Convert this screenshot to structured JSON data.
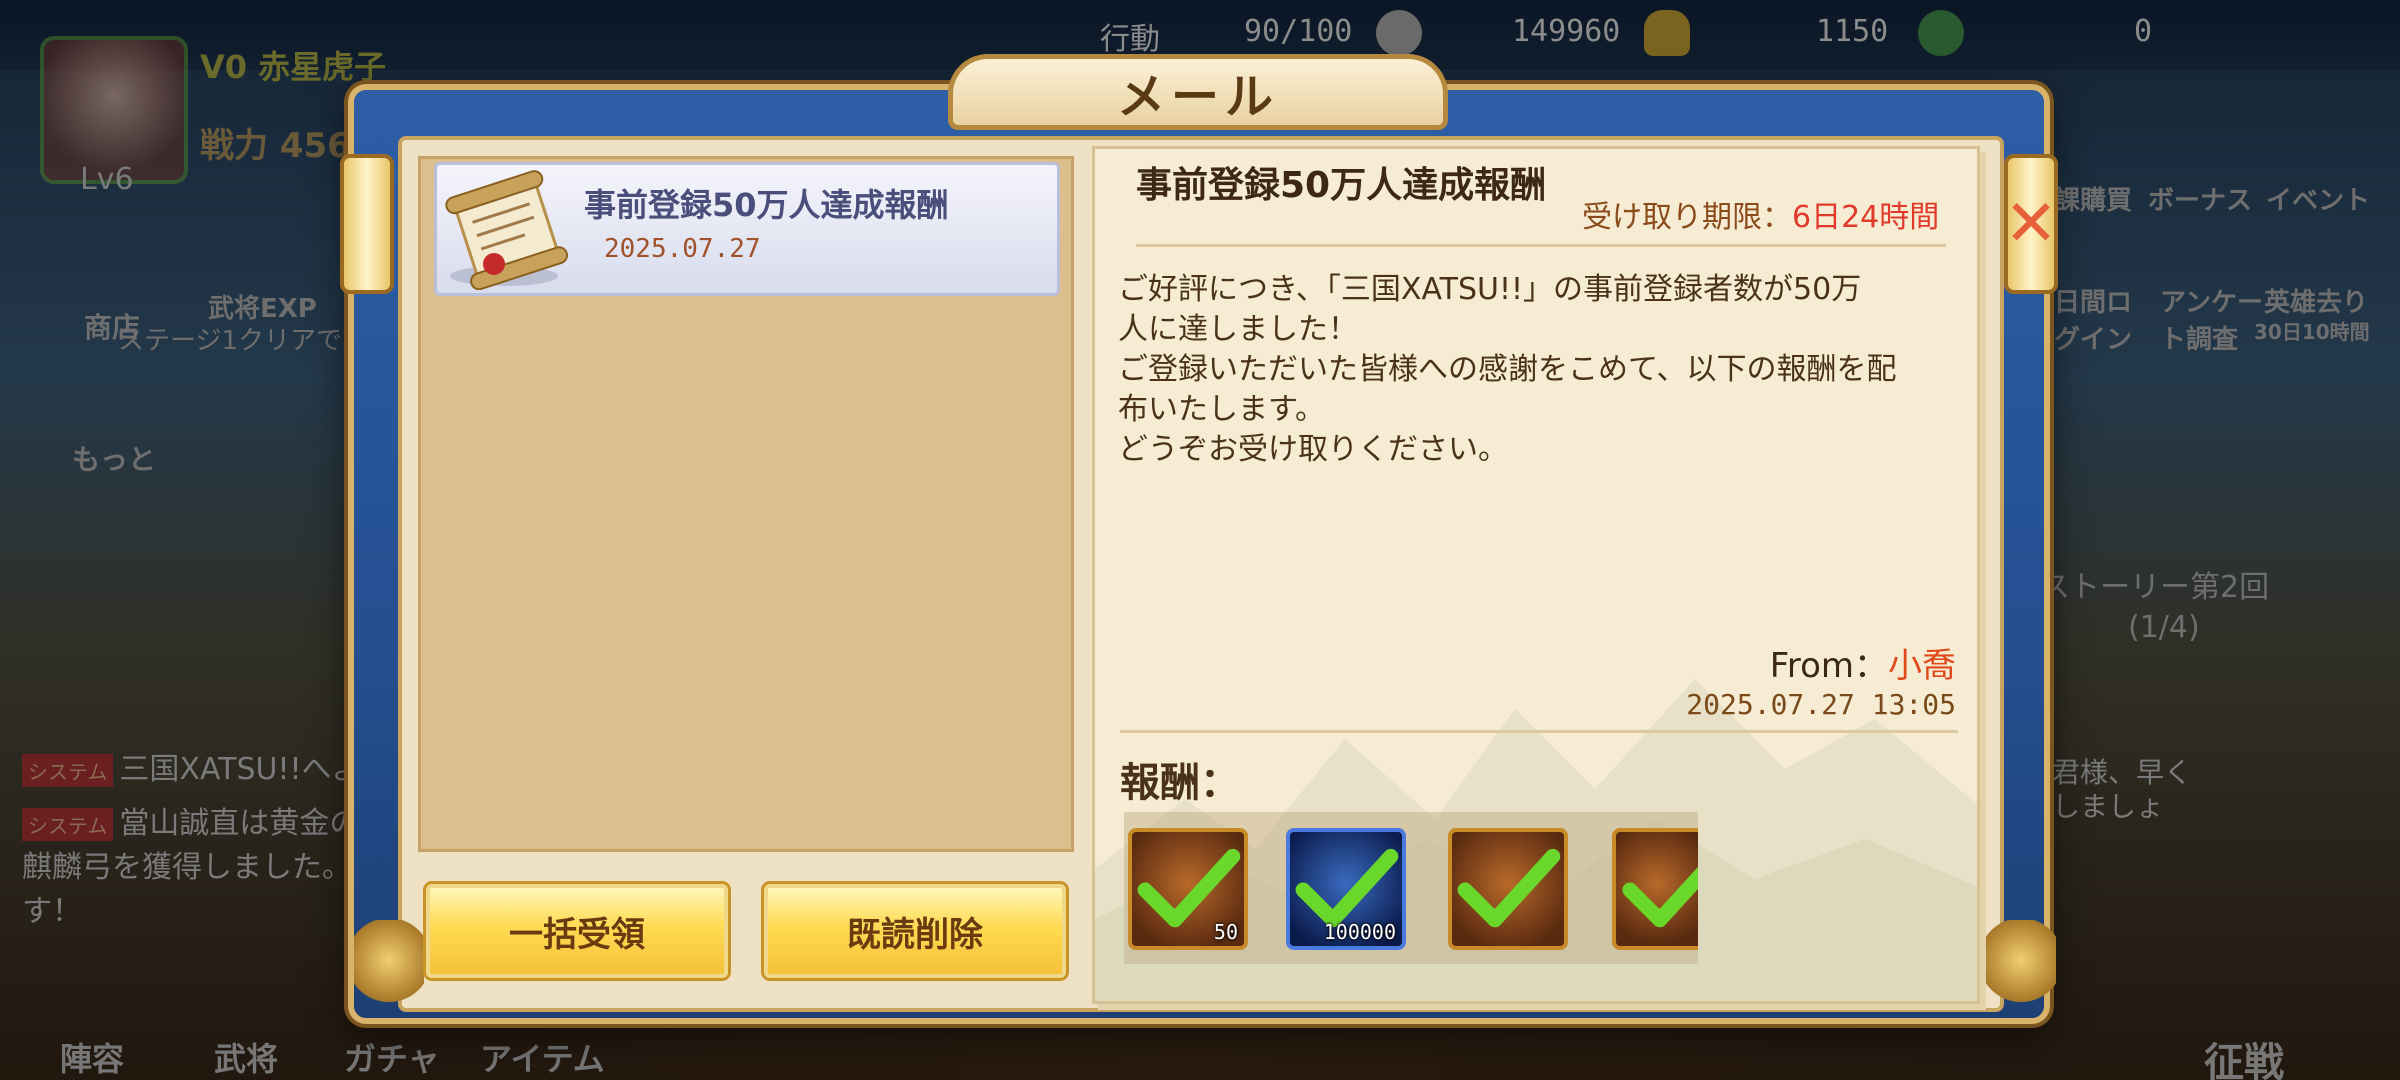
{
  "hud": {
    "stamina_label": "行動",
    "stamina": "90/100",
    "silver": "149960",
    "gold": "1150",
    "jade": "0",
    "player_name": "赤星虎子",
    "vip": "V0",
    "power_label": "戦力",
    "power": "456",
    "level": "Lv6"
  },
  "background": {
    "left_labels": [
      "商店",
      "武将EXP",
      "ステージ1クリアで",
      "もっと"
    ],
    "right_labels": [
      "課購買",
      "ボーナス",
      "イベント",
      "日間ロ\nグイン",
      "アンケー\nト調査",
      "英雄去り",
      "30日10時間",
      "ストーリー第2回",
      "(1/4)"
    ],
    "chat": [
      {
        "tag": "システム",
        "text": "三国XATSU!!へよ"
      },
      {
        "tag": "システム",
        "text": "當山誠直は黄金の"
      },
      {
        "tag": "",
        "text": "麒麟弓を獲得しました。"
      },
      {
        "tag": "",
        "text": "す！"
      }
    ],
    "bubble": "主君様、早く\n戦しましょ\n！",
    "bottom_nav": [
      "陣容",
      "武将",
      "ガチャ",
      "アイテム",
      "征戦"
    ]
  },
  "dialog": {
    "title": "メール",
    "close_icon": "close-icon"
  },
  "mail_list": {
    "items": [
      {
        "title": "事前登録50万人達成報酬",
        "date": "2025.07.27",
        "icon": "scroll-icon"
      }
    ]
  },
  "buttons": {
    "claim_all": "一括受領",
    "delete_read": "既読削除"
  },
  "mail_detail": {
    "title": "事前登録50万人達成報酬",
    "expiry_label": "受け取り期限：",
    "expiry_value": "6日24時間",
    "body": "ご好評につき、「三国XATSU!!」の事前登録者数が50万\n人に達しました！\nご登録いただいた皆様への感謝をこめて、以下の報酬を配\n布いたします。\nどうぞお受け取りください。",
    "from_label": "From：",
    "from_name": "小喬",
    "sent_at": "2025.07.27 13:05",
    "reward_label": "報酬：",
    "rewards": [
      {
        "qty": "50",
        "frame": "gold",
        "claimed": true
      },
      {
        "qty": "100000",
        "frame": "blue",
        "claimed": true
      },
      {
        "qty": "",
        "frame": "gold",
        "claimed": true
      },
      {
        "qty": "",
        "frame": "gold",
        "claimed": true
      }
    ]
  },
  "colors": {
    "frame_blue": "#2e5ea6",
    "button_gold": "#ffdb52",
    "expiry_red": "#e23a2a",
    "from_red": "#e04a1a",
    "check_green": "#6ad82a"
  }
}
